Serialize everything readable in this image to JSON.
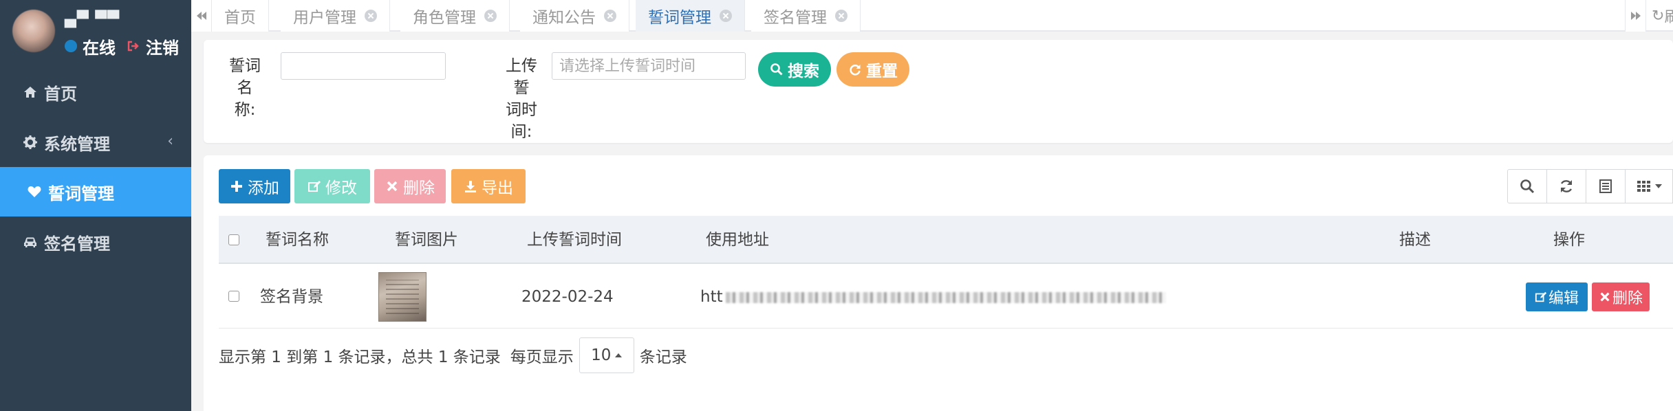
{
  "user": {
    "name": "▄▀ ▀▀",
    "status": "在线",
    "logout": "注销"
  },
  "sidebar": {
    "items": [
      {
        "label": "首页",
        "icon": "home-icon"
      },
      {
        "label": "系统管理",
        "icon": "gear-icon"
      },
      {
        "label": "誓词管理",
        "icon": "heart-icon"
      },
      {
        "label": "签名管理",
        "icon": "car-icon"
      }
    ]
  },
  "tabs": [
    {
      "label": "首页"
    },
    {
      "label": "用户管理"
    },
    {
      "label": "角色管理"
    },
    {
      "label": "通知公告"
    },
    {
      "label": "誓词管理"
    },
    {
      "label": "签名管理"
    }
  ],
  "topbar": {
    "refresh_label": "刷新"
  },
  "search": {
    "name_label_line1": "誓词名",
    "name_label_line2": "称:",
    "name_value": "",
    "time_label_line1": "上传誓",
    "time_label_line2": "词时",
    "time_label_line3": "间:",
    "time_placeholder": "请选择上传誓词时间",
    "search_button": "搜索",
    "reset_button": "重置"
  },
  "toolbar": {
    "add": "添加",
    "edit": "修改",
    "delete": "删除",
    "export": "导出"
  },
  "table": {
    "columns": [
      "誓词名称",
      "誓词图片",
      "上传誓词时间",
      "使用地址",
      "描述",
      "操作"
    ],
    "rows": [
      {
        "name": "签名背景",
        "date": "2022-02-24",
        "url_prefix": "htt",
        "edit": "编辑",
        "delete": "删除"
      }
    ]
  },
  "pager": {
    "summary": "显示第 1 到第 1 条记录，总共 1 条记录",
    "per_page_prefix": "每页显示",
    "per_page_value": "10",
    "per_page_suffix": "条记录"
  },
  "colors": {
    "sidebar_bg": "#2f4050",
    "active_nav": "#36a3f7",
    "primary": "#1c84c6",
    "success": "#1ab394",
    "warning": "#f8ac59",
    "danger": "#ed5565",
    "edit_light": "#7fdcc8",
    "delete_light": "#f3a4ad"
  }
}
